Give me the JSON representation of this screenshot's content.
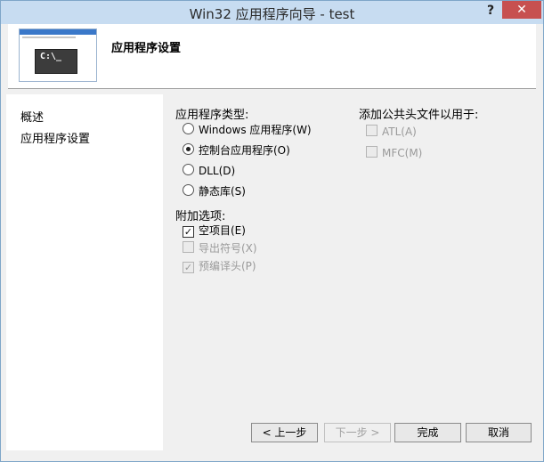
{
  "window": {
    "title": "Win32 应用程序向导 - test",
    "help": "?",
    "close": "✕"
  },
  "header": {
    "title": "应用程序设置",
    "thumb_console_text": "C:\\_"
  },
  "sidebar": {
    "items": [
      {
        "label": "概述"
      },
      {
        "label": "应用程序设置"
      }
    ]
  },
  "app_type": {
    "label": "应用程序类型:",
    "options": [
      {
        "label": "Windows 应用程序(W)",
        "selected": false
      },
      {
        "label": "控制台应用程序(O)",
        "selected": true
      },
      {
        "label": "DLL(D)",
        "selected": false
      },
      {
        "label": "静态库(S)",
        "selected": false
      }
    ]
  },
  "extra": {
    "label": "附加选项:",
    "options": [
      {
        "label": "空项目(E)",
        "checked": true,
        "enabled": true
      },
      {
        "label": "导出符号(X)",
        "checked": false,
        "enabled": false
      },
      {
        "label": "预编译头(P)",
        "checked": true,
        "enabled": false
      }
    ]
  },
  "common_headers": {
    "label": "添加公共头文件以用于:",
    "options": [
      {
        "label": "ATL(A)",
        "checked": false,
        "enabled": false
      },
      {
        "label": "MFC(M)",
        "checked": false,
        "enabled": false
      }
    ]
  },
  "buttons": {
    "prev": "< 上一步",
    "next": "下一步 >",
    "finish": "完成",
    "cancel": "取消"
  },
  "colors": {
    "titlebar": "#c7dcf1",
    "close": "#c75050",
    "disabled_text": "#9a9a9a"
  }
}
